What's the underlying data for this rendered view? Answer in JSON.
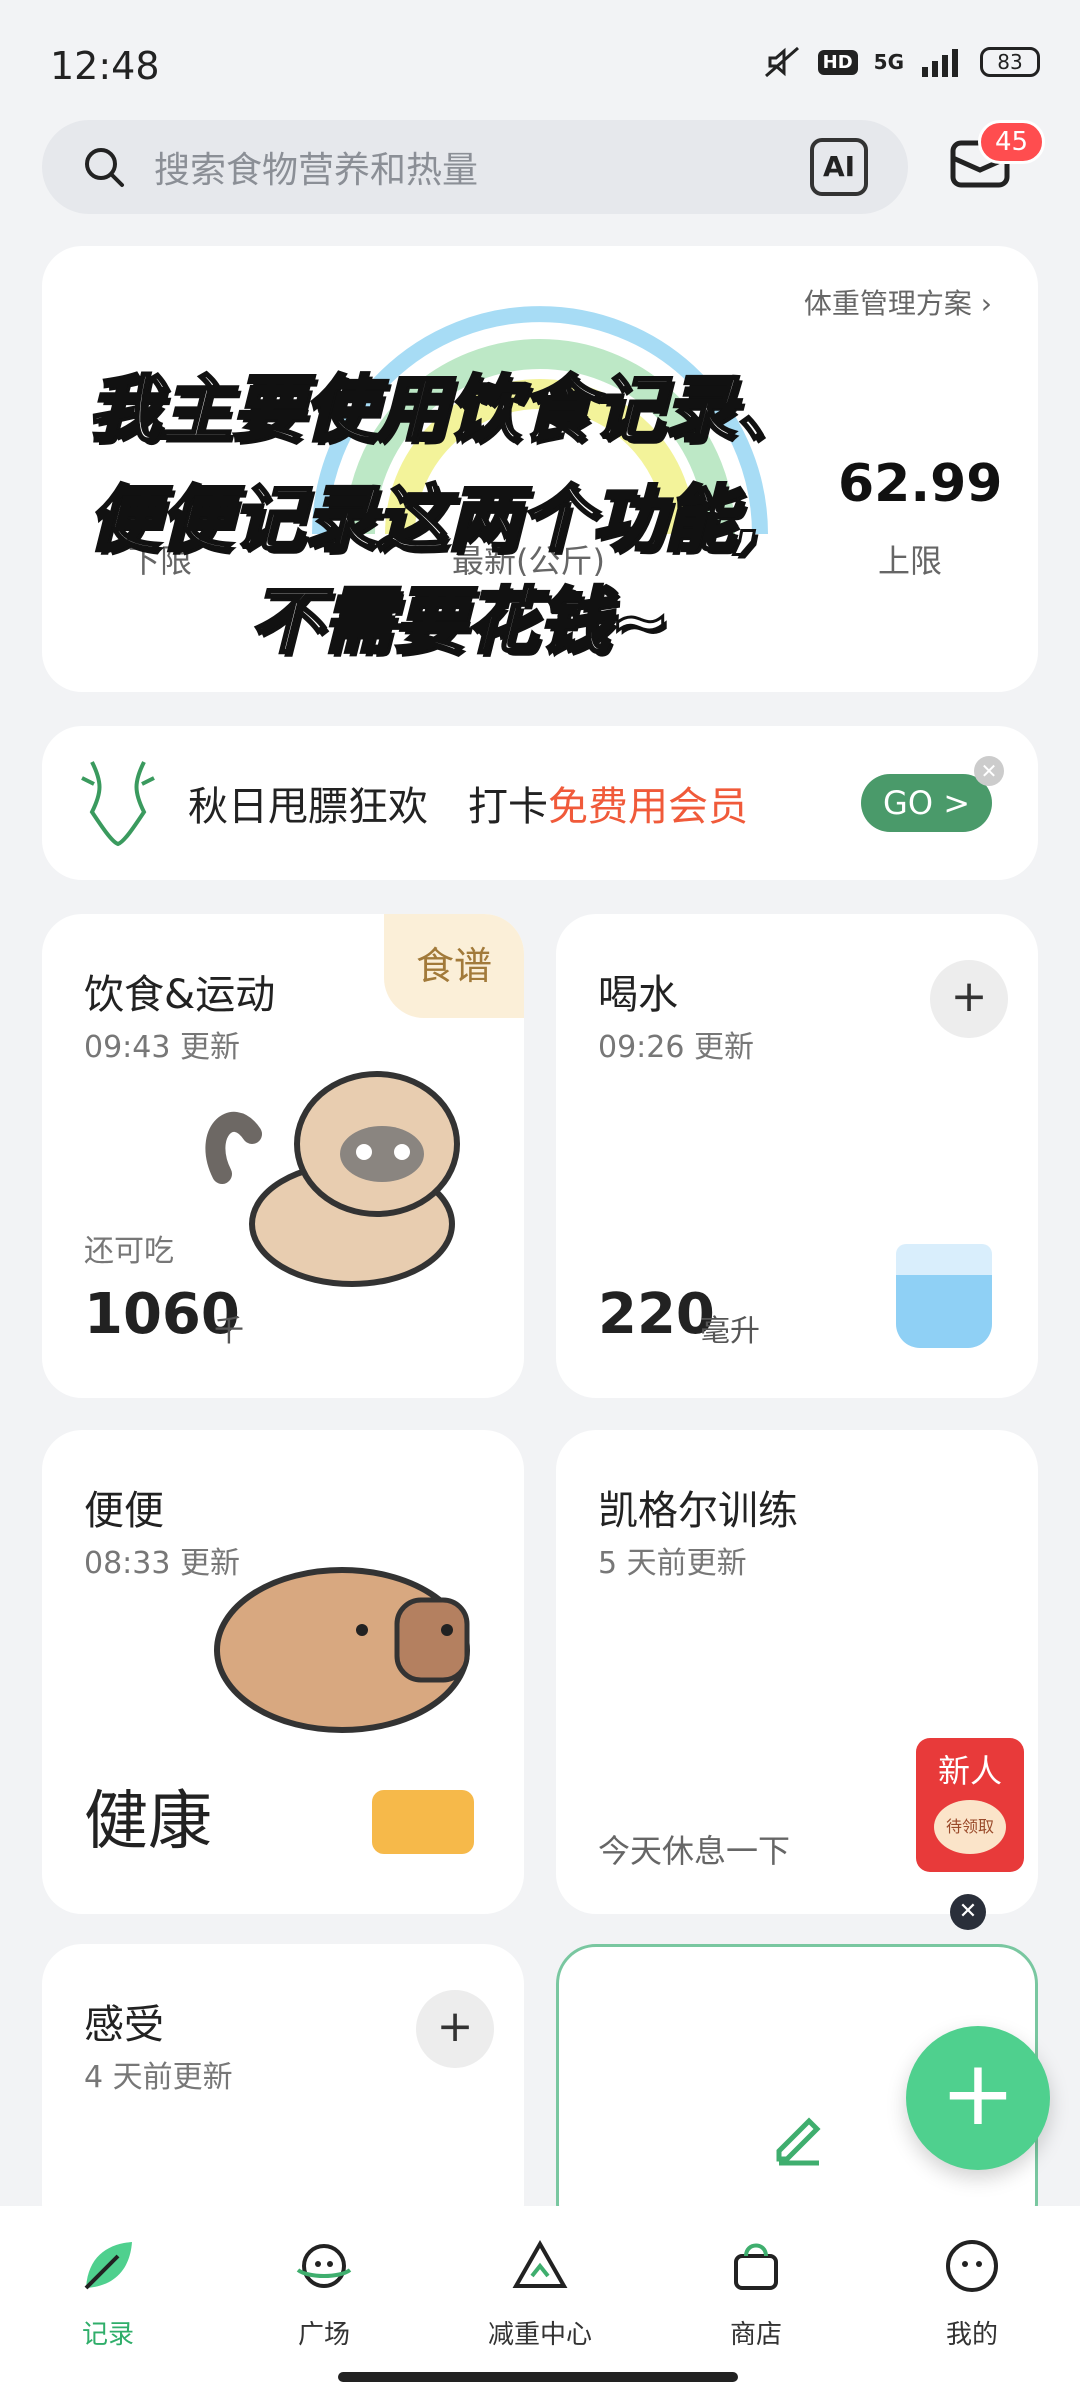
{
  "status_bar": {
    "time": "12:48",
    "network": "5G",
    "battery": "83"
  },
  "search": {
    "placeholder": "搜索食物营养和热量",
    "ai_label": "AI"
  },
  "messages": {
    "badge": "45"
  },
  "weight_card": {
    "plan_link": "体重管理方案",
    "lower_label": "下限",
    "upper_label": "上限",
    "upper_value": "62.99",
    "current_label": "最新(公斤)"
  },
  "overlay_caption": {
    "line1": "我主要使用饮食记录、",
    "line2": "便便记录这两个功能,",
    "line3": "不需要花钱~"
  },
  "promo": {
    "title": "秋日甩膘狂欢",
    "action_prefix": "打卡",
    "action_highlight": "免费用会员",
    "go_label": "GO >"
  },
  "tiles": {
    "diet": {
      "title": "饮食&运动",
      "updated": "09:43 更新",
      "tag": "食谱",
      "remain_label": "还可吃",
      "value": "1060",
      "unit": "千"
    },
    "water": {
      "title": "喝水",
      "updated": "09:26 更新",
      "value": "220",
      "unit": "毫升"
    },
    "poop": {
      "title": "便便",
      "updated": "08:33 更新",
      "status": "健康"
    },
    "kegel": {
      "title": "凯格尔训练",
      "updated": "5 天前更新",
      "status": "今天休息一下"
    },
    "feeling": {
      "title": "感受",
      "updated": "4 天前更新"
    }
  },
  "new_user": {
    "title": "新人",
    "action": "待领取"
  },
  "tabbar": {
    "items": [
      {
        "label": "记录",
        "icon": "leaf-icon",
        "active": true
      },
      {
        "label": "广场",
        "icon": "planet-icon",
        "active": false
      },
      {
        "label": "减重中心",
        "icon": "triangle-icon",
        "active": false
      },
      {
        "label": "商店",
        "icon": "bag-icon",
        "active": false
      },
      {
        "label": "我的",
        "icon": "face-icon",
        "active": false
      }
    ]
  },
  "colors": {
    "accent_green": "#2fae6a",
    "fab_green": "#4fd08e",
    "highlight_red": "#f05a3a",
    "badge_red": "#ff4d4f"
  }
}
